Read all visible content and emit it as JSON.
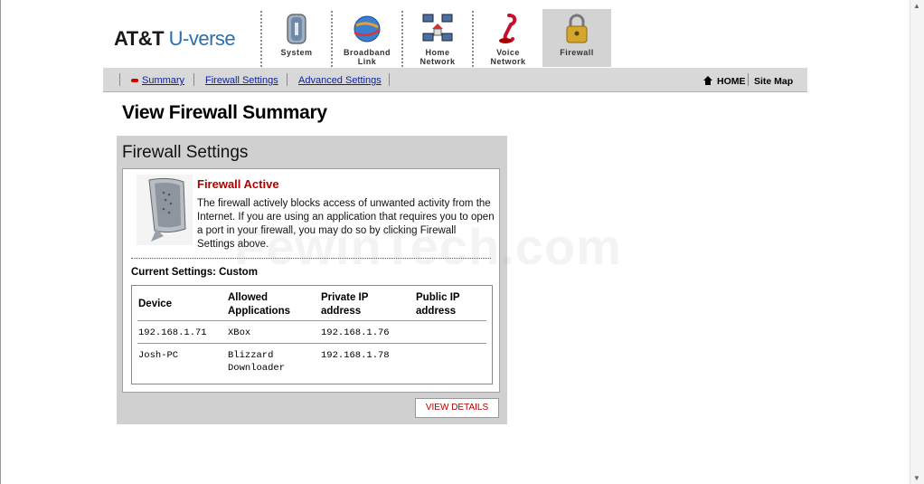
{
  "header": {
    "logo_att": "AT&T",
    "logo_uverse": "U-verse",
    "tabs": [
      {
        "label_l1": "System",
        "label_l2": "",
        "icon": "system-icon"
      },
      {
        "label_l1": "Broadband",
        "label_l2": "Link",
        "icon": "globe-icon"
      },
      {
        "label_l1": "Home",
        "label_l2": "Network",
        "icon": "home-network-icon"
      },
      {
        "label_l1": "Voice",
        "label_l2": "Network",
        "icon": "phone-icon"
      },
      {
        "label_l1": "Firewall",
        "label_l2": "",
        "icon": "padlock-icon",
        "active": true
      }
    ]
  },
  "subnav": {
    "items": [
      "Summary",
      "Firewall Settings",
      "Advanced Settings"
    ],
    "home": "HOME",
    "sitemap": "Site Map"
  },
  "page": {
    "title": "View Firewall Summary"
  },
  "panel": {
    "title": "Firewall Settings",
    "status_heading": "Firewall Active",
    "description": "The firewall actively blocks access of unwanted activity from the Internet. If you are using an application that requires you to open a port in your firewall, you may do so by clicking Firewall Settings above.",
    "current_settings": "Current Settings: Custom",
    "table": {
      "headers": [
        "Device",
        "Allowed Applications",
        "Private IP address",
        "Public IP address"
      ],
      "rows": [
        {
          "device": "192.168.1.71",
          "apps": "XBox",
          "private_ip": "192.168.1.76",
          "public_ip": ""
        },
        {
          "device": "Josh-PC",
          "apps": "Blizzard Downloader",
          "private_ip": "192.168.1.78",
          "public_ip": ""
        }
      ]
    },
    "button": "VIEW DETAILS"
  },
  "watermark": "FewinTech.com",
  "colors": {
    "accent_red": "#b00000",
    "link_blue": "#0b1f9c",
    "brand_blue": "#2a6fb0"
  }
}
